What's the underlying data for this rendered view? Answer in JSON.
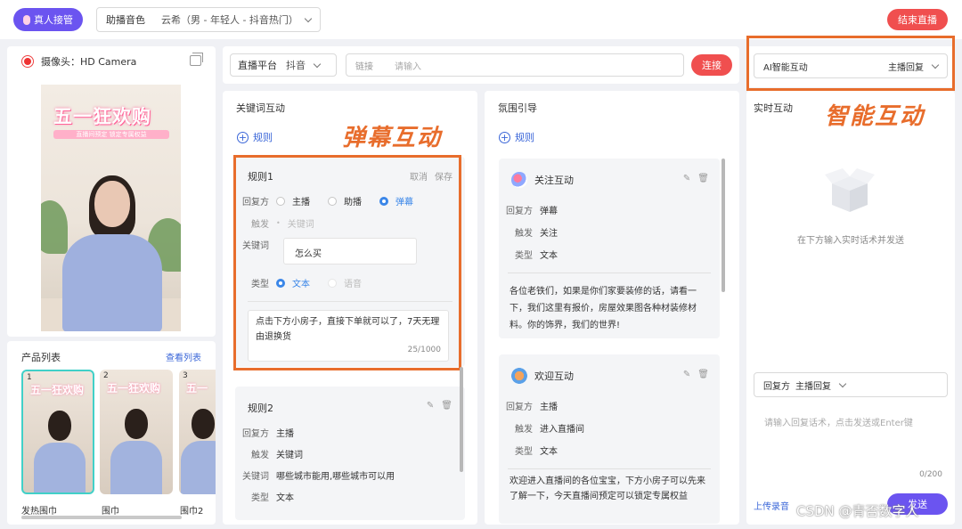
{
  "header": {
    "human_takeover": "真人接管",
    "voice_label": "助播音色",
    "voice_value": "云希（男 - 年轻人 - 抖音热门）",
    "end_live": "结束直播"
  },
  "camera": {
    "label": "摄像头：HD Camera",
    "banner": "五一狂欢购",
    "banner_sub": "直播间预定 锁定专属权益"
  },
  "products": {
    "title": "产品列表",
    "view_link": "查看列表",
    "items": [
      {
        "num": "1",
        "name": "发热围巾",
        "banner": "五一狂欢购"
      },
      {
        "num": "2",
        "name": "围巾",
        "banner": "五一狂欢购"
      },
      {
        "num": "3",
        "name": "围巾2",
        "banner": "五一"
      }
    ]
  },
  "platform": {
    "label": "直播平台",
    "value": "抖音",
    "link_label": "链接",
    "link_placeholder": "请输入",
    "connect": "连接"
  },
  "keyword": {
    "title": "关键词互动",
    "add_rule": "规则",
    "overlay_label": "弹幕互动",
    "rule1": {
      "name": "规则1",
      "cancel": "取消",
      "save": "保存",
      "reply_label": "回复方",
      "reply_options": [
        "主播",
        "助播",
        "弹幕"
      ],
      "trigger_label": "触发",
      "trigger_value": "关键词",
      "keyword_label": "关键词",
      "keyword_value": "怎么买",
      "type_label": "类型",
      "type_options": [
        "文本",
        "语音"
      ],
      "content": "点击下方小房子，直接下单就可以了，7天无理由退换货",
      "counter": "25/1000"
    },
    "rule2": {
      "name": "规则2",
      "reply_label": "回复方",
      "reply_value": "主播",
      "trigger_label": "触发",
      "trigger_value": "关键词",
      "keyword_label": "关键词",
      "keyword_value": "哪些城市能用,哪些城市可以用",
      "type_label": "类型",
      "type_value": "文本"
    }
  },
  "atmosphere": {
    "title": "氛围引导",
    "add_rule": "规则",
    "card1": {
      "name": "关注互动",
      "reply_label": "回复方",
      "reply_value": "弹幕",
      "trigger_label": "触发",
      "trigger_value": "关注",
      "type_label": "类型",
      "type_value": "文本",
      "content": "各位老铁们，如果是你们家要装修的话，请看一下，我们这里有报价，房屋效果图各种材装修材料。你的饰界，我们的世界!"
    },
    "card2": {
      "name": "欢迎互动",
      "reply_label": "回复方",
      "reply_value": "主播",
      "trigger_label": "触发",
      "trigger_value": "进入直播间",
      "type_label": "类型",
      "type_value": "文本",
      "content": "欢迎进入直播间的各位宝宝，下方小房子可以先来了解一下，今天直播间预定可以锁定专属权益"
    }
  },
  "ai": {
    "label": "AI智能互动",
    "value": "主播回复",
    "overlay_label": "智能互动"
  },
  "realtime": {
    "title": "实时互动",
    "empty_text": "在下方输入实时话术并发送",
    "reply_label": "回复方",
    "reply_value": "主播回复",
    "input_placeholder": "请输入回复话术，点击发送或Enter键",
    "counter": "0/200",
    "upload": "上传录音",
    "send": "发送"
  },
  "watermark": "CSDN @青否数字人",
  "colors": {
    "accent_red": "#f04f4f",
    "accent_purple": "#6b54f0",
    "link_blue": "#3a66d8",
    "highlight_orange": "#e86d2c"
  }
}
